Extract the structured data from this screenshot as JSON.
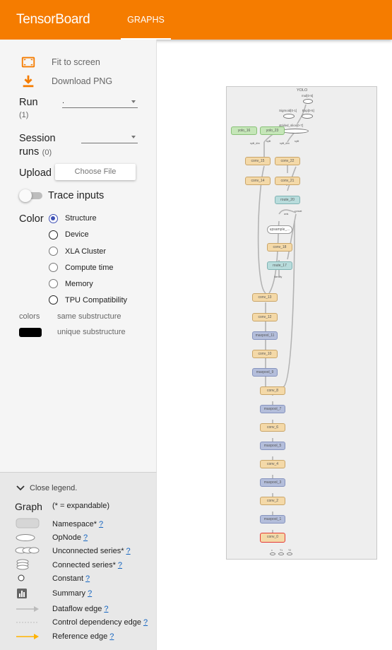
{
  "header": {
    "brand": "TensorBoard",
    "tab": "GRAPHS"
  },
  "controls": {
    "fit_label": "Fit to screen",
    "download_label": "Download PNG",
    "run": {
      "label": "Run",
      "count": "(1)",
      "value": "."
    },
    "session": {
      "label_line1": "Session",
      "label_line2": "runs",
      "count": "(0)",
      "value": ""
    },
    "upload": {
      "label": "Upload",
      "button": "Choose File"
    },
    "trace": {
      "label": "Trace inputs"
    },
    "color": {
      "label": "Color",
      "options": [
        "Structure",
        "Device",
        "XLA Cluster",
        "Compute time",
        "Memory",
        "TPU Compatibility"
      ],
      "selected": "Structure"
    },
    "colors": {
      "label": "colors",
      "same": "same substructure",
      "unique": "unique substructure"
    }
  },
  "legend": {
    "close": "Close legend.",
    "title": "Graph",
    "note": "(* = expandable)",
    "help": "?",
    "items": [
      "Namespace*",
      "OpNode",
      "Unconnected series*",
      "Connected series*",
      "Constant",
      "Summary",
      "Dataflow edge",
      "Control dependency edge",
      "Reference edge"
    ]
  },
  "graph": {
    "top": "YOLO",
    "ops": [
      "mul[0-5]",
      "Sigmoid[0-1]",
      "Exp[0-5]",
      "strided_slice[0-7]"
    ],
    "yolo": [
      "yolo_16",
      "yolo_23"
    ],
    "split_labels": [
      "split_dim",
      "split",
      "split_dim",
      "split"
    ],
    "conv_right": [
      "conv_22",
      "conv_21"
    ],
    "conv_left": [
      "conv_15",
      "conv_14"
    ],
    "route_20": "route_20",
    "concat": [
      "axis",
      "concat"
    ],
    "upsample": "upsample_...",
    "conv_18": "conv_18",
    "route_17": "route_17",
    "identity": "Identity",
    "conv_13": "conv_13",
    "conv_12": "conv_12",
    "maxpool_11": "maxpool_11",
    "conv_10": "conv_10",
    "maxpool_9": "maxpool_9",
    "conv_8": "conv_8",
    "maxpool_7": "maxpool_7",
    "conv_6": "conv_6",
    "maxpool_5": "maxpool_5",
    "conv_4": "conv_4",
    "maxpool_3": "maxpool_3",
    "conv_2": "conv_2",
    "maxpool_1": "maxpool_1",
    "conv_0": "conv_0",
    "inputs": [
      "x",
      "T1",
      "T2"
    ]
  },
  "colors_hex": {
    "accent": "#f57c00",
    "radio": "#3f51b5",
    "conv": "#f4d9a8",
    "pool": "#b4bedb",
    "route": "#b8dcdc",
    "yolo": "#c5e6b8",
    "selected": "#e53935",
    "reference_edge": "#ffb300"
  }
}
